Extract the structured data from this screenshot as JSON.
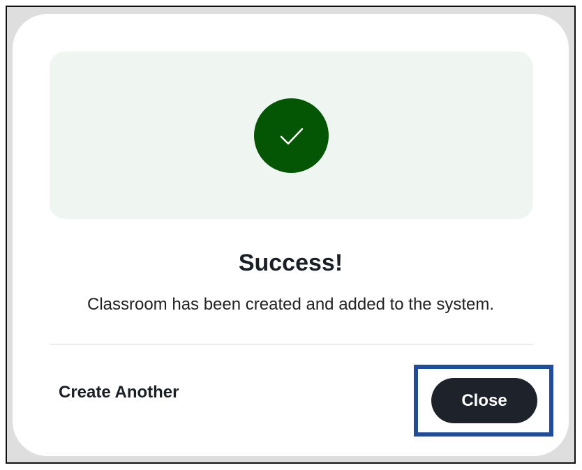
{
  "dialog": {
    "title": "Success!",
    "message": "Classroom has been created and added to the system.",
    "icon": "checkmark-icon",
    "icon_color": "#045504",
    "hero_background": "#eff6f2"
  },
  "actions": {
    "secondary_label": "Create Another",
    "primary_label": "Close",
    "primary_background": "#1d222b",
    "highlight_color": "#1f4d9b"
  }
}
